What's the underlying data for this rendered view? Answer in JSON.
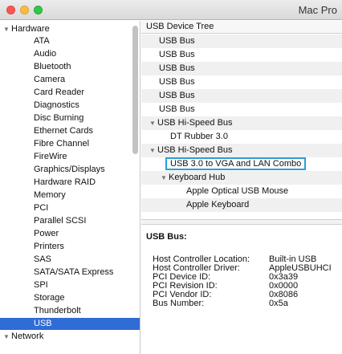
{
  "window": {
    "title": "Mac Pro"
  },
  "sidebar": {
    "items": [
      {
        "label": "Hardware",
        "type": "category",
        "expanded": true
      },
      {
        "label": "ATA"
      },
      {
        "label": "Audio"
      },
      {
        "label": "Bluetooth"
      },
      {
        "label": "Camera"
      },
      {
        "label": "Card Reader"
      },
      {
        "label": "Diagnostics"
      },
      {
        "label": "Disc Burning"
      },
      {
        "label": "Ethernet Cards"
      },
      {
        "label": "Fibre Channel"
      },
      {
        "label": "FireWire"
      },
      {
        "label": "Graphics/Displays"
      },
      {
        "label": "Hardware RAID"
      },
      {
        "label": "Memory"
      },
      {
        "label": "PCI"
      },
      {
        "label": "Parallel SCSI"
      },
      {
        "label": "Power"
      },
      {
        "label": "Printers"
      },
      {
        "label": "SAS"
      },
      {
        "label": "SATA/SATA Express"
      },
      {
        "label": "SPI"
      },
      {
        "label": "Storage"
      },
      {
        "label": "Thunderbolt"
      },
      {
        "label": "USB",
        "selected": true
      },
      {
        "label": "Network",
        "type": "category",
        "expanded": true
      }
    ]
  },
  "device_tree": {
    "header": "USB Device Tree",
    "rows": [
      {
        "label": "USB Bus"
      },
      {
        "label": "USB Bus"
      },
      {
        "label": "USB Bus"
      },
      {
        "label": "USB Bus"
      },
      {
        "label": "USB Bus"
      },
      {
        "label": "USB Bus"
      },
      {
        "label": "USB Hi-Speed Bus",
        "expanded": true
      },
      {
        "label": "DT Rubber 3.0"
      },
      {
        "label": "USB Hi-Speed Bus",
        "expanded": true
      },
      {
        "label": "USB 3.0 to VGA and LAN Combo",
        "highlighted": true
      },
      {
        "label": "Keyboard Hub",
        "expanded": true
      },
      {
        "label": "Apple Optical USB Mouse"
      },
      {
        "label": "Apple Keyboard"
      }
    ]
  },
  "details": {
    "title": "USB Bus:",
    "rows": [
      {
        "key": "Host Controller Location:",
        "value": "Built-in USB"
      },
      {
        "key": "Host Controller Driver:",
        "value": "AppleUSBUHCI"
      },
      {
        "key": "PCI Device ID:",
        "value": "0x3a39"
      },
      {
        "key": "PCI Revision ID:",
        "value": "0x0000"
      },
      {
        "key": "PCI Vendor ID:",
        "value": "0x8086"
      },
      {
        "key": "Bus Number:",
        "value": "0x5a"
      }
    ]
  },
  "colors": {
    "selection": "#2f6cd6",
    "highlight_border": "#2a9fd6"
  },
  "icons": {
    "disclosure": "disclosure-triangle-icon"
  }
}
